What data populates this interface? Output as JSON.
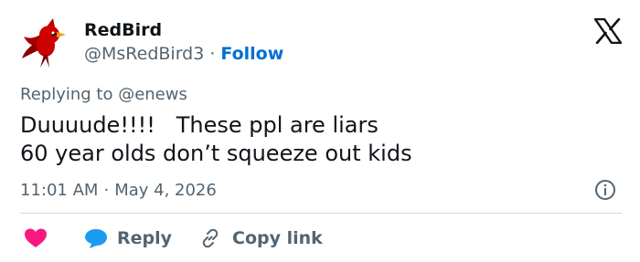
{
  "user": {
    "name": "RedBird",
    "handle": "@MsRedBird3",
    "separator": "·",
    "follow_label": "Follow"
  },
  "tweet": {
    "replying_to": "Replying to @enews",
    "text": "Duuuude!!!!   These ppl are liars\n60 year olds don’t squeeze out kids",
    "time": "11:01 AM",
    "date": "May 4, 2026",
    "meta_separator": "·"
  },
  "actions": {
    "reply_label": "Reply",
    "copy_link_label": "Copy link"
  },
  "icons": {
    "logo": "x-logo-icon",
    "info": "info-icon",
    "like": "heart-icon",
    "reply": "speech-bubble-icon",
    "copy": "link-icon"
  },
  "colors": {
    "text_primary": "#0f1419",
    "text_secondary": "#536471",
    "link_blue": "#006fd6",
    "like_pink": "#f91880",
    "reply_blue": "#1d9bf0",
    "divider": "#cfd9de"
  }
}
